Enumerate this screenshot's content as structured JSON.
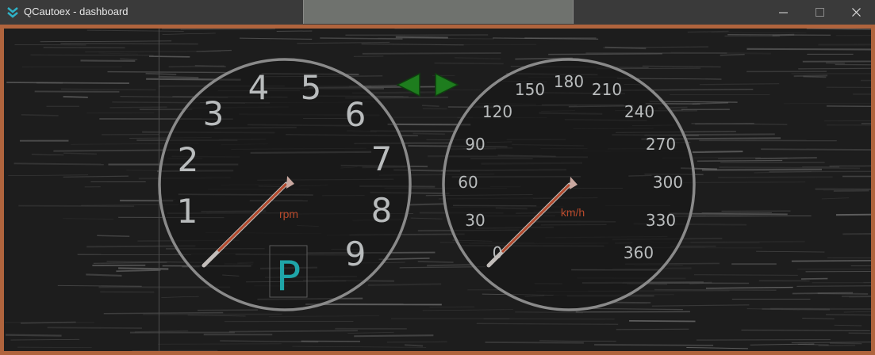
{
  "window": {
    "title": "QCautoex - dashboard",
    "app_icon": "double-chevron-down-icon",
    "controls": [
      "minimize-icon",
      "maximize-icon",
      "close-icon"
    ],
    "frame_color": "#b0643d"
  },
  "dashboard": {
    "turn_signals": {
      "left": "arrow-left-icon",
      "right": "arrow-right-icon",
      "color": "#1e7d1e"
    },
    "tachometer": {
      "unit": "rpm",
      "ticks": [
        "1",
        "2",
        "3",
        "4",
        "5",
        "6",
        "7",
        "8",
        "9"
      ],
      "value": 0,
      "gear": "P",
      "gear_color": "#1fa5a8"
    },
    "speedometer": {
      "unit": "km/h",
      "ticks": [
        "0",
        "30",
        "60",
        "90",
        "120",
        "150",
        "180",
        "210",
        "240",
        "270",
        "300",
        "330",
        "360"
      ],
      "value": 0
    },
    "needle_color": "#b24a2e",
    "tick_color": "#b9bcbd",
    "unit_color": "#b84a2c"
  }
}
